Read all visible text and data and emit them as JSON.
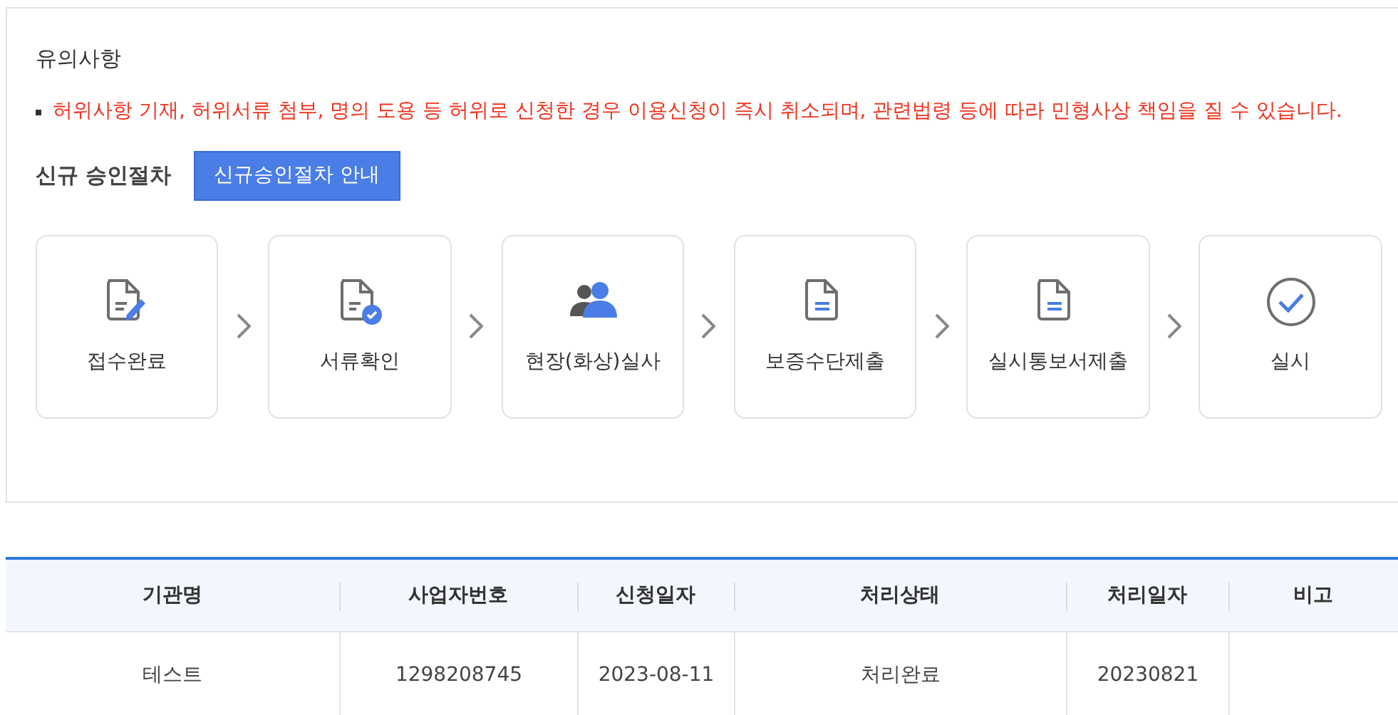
{
  "notice": {
    "title": "유의사항",
    "items": [
      "허위사항 기재, 허위서류 첨부, 명의 도용 등 허위로 신청한 경우 이용신청이 즉시 취소되며, 관련법령 등에 따라 민형사상 책임을 질 수 있습니다."
    ]
  },
  "procedure": {
    "label": "신규 승인절차",
    "button": "신규승인절차 안내",
    "steps": [
      {
        "label": "접수완료"
      },
      {
        "label": "서류확인"
      },
      {
        "label": "현장(화상)실사"
      },
      {
        "label": "보증수단제출"
      },
      {
        "label": "실시통보서제출"
      },
      {
        "label": "실시"
      }
    ]
  },
  "table": {
    "columns": [
      "기관명",
      "사업자번호",
      "신청일자",
      "처리상태",
      "처리일자",
      "비고"
    ],
    "rows": [
      [
        "테스트",
        "1298208745",
        "2023-08-11",
        "처리완료",
        "20230821",
        ""
      ]
    ]
  }
}
